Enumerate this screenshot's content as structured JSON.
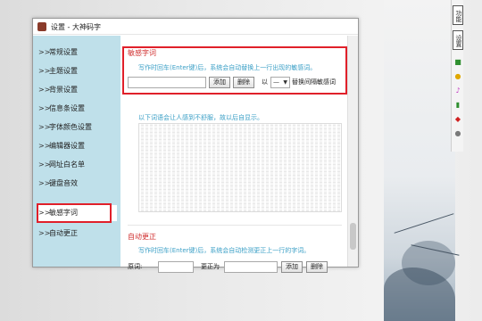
{
  "window": {
    "title": "设置 - 大神码字"
  },
  "sidebar": {
    "items": [
      {
        "label": "常规设置"
      },
      {
        "label": "主题设置"
      },
      {
        "label": "背景设置"
      },
      {
        "label": "信息条设置"
      },
      {
        "label": "字体颜色设置"
      },
      {
        "label": "编辑器设置"
      },
      {
        "label": "网址白名单"
      },
      {
        "label": "键盘音效"
      },
      {
        "label": "敏感字词"
      },
      {
        "label": "自动更正"
      }
    ],
    "active_index": 8
  },
  "sensitive": {
    "title": "敏感字词",
    "hint": "写作时回车(Enter键)后，系统会自动替换上一行出现的敏感词。",
    "input_value": "",
    "add_label": "添加",
    "delete_label": "删除",
    "replace_prefix": "以",
    "replace_value": "—",
    "replace_suffix": "替换间隔敏感词",
    "list_hint": "以下词语会让人感到不舒服，故以后自显示。"
  },
  "autocorrect": {
    "title": "自动更正",
    "hint": "写作时回车(Enter键)后，系统会自动检测更正上一行的字词。",
    "original_label": "原词:",
    "replace_label": "更正为",
    "original_value": "",
    "replace_value": "",
    "add_label": "添加",
    "delete_label": "删除"
  },
  "right_toolbar": {
    "btn1": "功能",
    "btn2": "设置"
  },
  "colors": {
    "accent": "#e0202a",
    "hint": "#3a9fc6",
    "sidebar": "#bfe0ea"
  }
}
